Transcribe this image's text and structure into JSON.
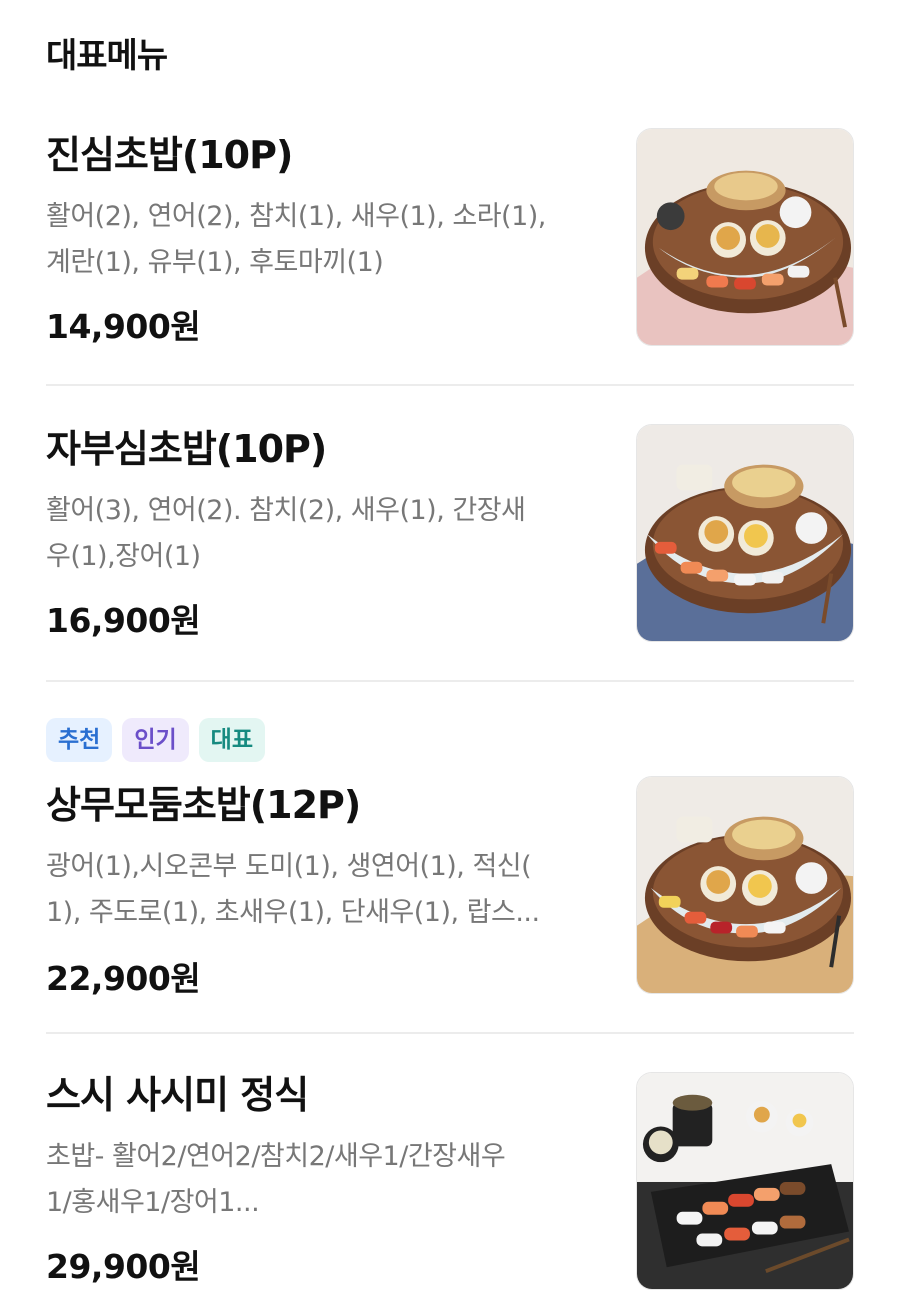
{
  "section_title": "대표메뉴",
  "items": [
    {
      "name": "진심초밥(10P)",
      "desc_lines": [
        "활어(2), 연어(2), 참치(1), 새우(1), 소라(1),",
        "계란(1), 유부(1), 후토마끼(1)"
      ],
      "price": "14,900원",
      "image": "sushi-platter-photo"
    },
    {
      "name": "자부심초밥(10P)",
      "desc_lines": [
        "활어(3), 연어(2). 참치(2), 새우(1), 간장새",
        "우(1),장어(1)"
      ],
      "price": "16,900원",
      "image": "sushi-platter-photo"
    },
    {
      "badges": [
        "추천",
        "인기",
        "대표"
      ],
      "name": "상무모둠초밥(12P)",
      "desc_lines": [
        "광어(1),시오콘부 도미(1), 생연어(1), 적신(",
        "1), 주도로(1), 초새우(1), 단새우(1), 랍스..."
      ],
      "price": "22,900원",
      "image": "sushi-platter-photo"
    },
    {
      "name": "스시 사시미 정식",
      "desc_lines": [
        "초밥- 활어2/연어2/참치2/새우1/간장새우",
        "1/홍새우1/장어1..."
      ],
      "price": "29,900원",
      "image": "sushi-set-photo"
    }
  ],
  "colors": {
    "badge_recommend": "#2a6fd1",
    "badge_popular": "#6b4fc9",
    "badge_signature": "#168a80"
  }
}
